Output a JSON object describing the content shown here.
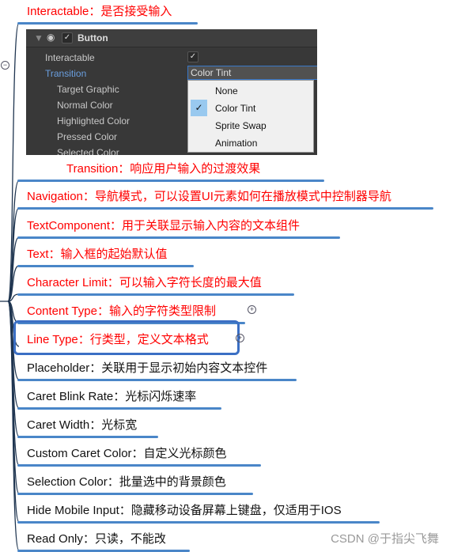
{
  "nodes": [
    {
      "label": "Interactable：是否接受输入",
      "color": "red"
    },
    {
      "label": "Transition：响应用户输入的过渡效果",
      "color": "red"
    },
    {
      "label": "Navigation：导航模式，可以设置UI元素如何在播放模式中控制器导航",
      "color": "red"
    },
    {
      "label": "TextComponent：用于关联显示输入内容的文本组件",
      "color": "red"
    },
    {
      "label": "Text：输入框的起始默认值",
      "color": "red"
    },
    {
      "label": "Character Limit：可以输入字符长度的最大值",
      "color": "red"
    },
    {
      "label": "Content Type：输入的字符类型限制",
      "color": "red"
    },
    {
      "label": "Line Type：行类型，定义文本格式",
      "color": "red"
    },
    {
      "label": "Placeholder：关联用于显示初始内容文本控件",
      "color": "black"
    },
    {
      "label": "Caret Blink Rate：光标闪烁速率",
      "color": "black"
    },
    {
      "label": "Caret Width：光标宽",
      "color": "black"
    },
    {
      "label": "Custom Caret Color：自定义光标颜色",
      "color": "black"
    },
    {
      "label": "Selection Color：批量选中的背景颜色",
      "color": "black"
    },
    {
      "label": "Hide Mobile Input：隐藏移动设备屏幕上键盘，仅适用于IOS",
      "color": "black"
    },
    {
      "label": "Read Only：只读，不能改",
      "color": "black"
    }
  ],
  "unity": {
    "component": "Button",
    "fields": [
      "Interactable",
      "Transition",
      "Target Graphic",
      "Normal Color",
      "Highlighted Color",
      "Pressed Color",
      "Selected Color"
    ],
    "dropdown_value": "Color Tint",
    "menu": [
      "None",
      "Color Tint",
      "Sprite Swap",
      "Animation"
    ],
    "selected": "Color Tint"
  },
  "watermark": "CSDN @于指尖飞舞",
  "colors": {
    "accent": "#4a86c8",
    "red": "#ff0000",
    "selection_box": "#3b6fc4"
  }
}
